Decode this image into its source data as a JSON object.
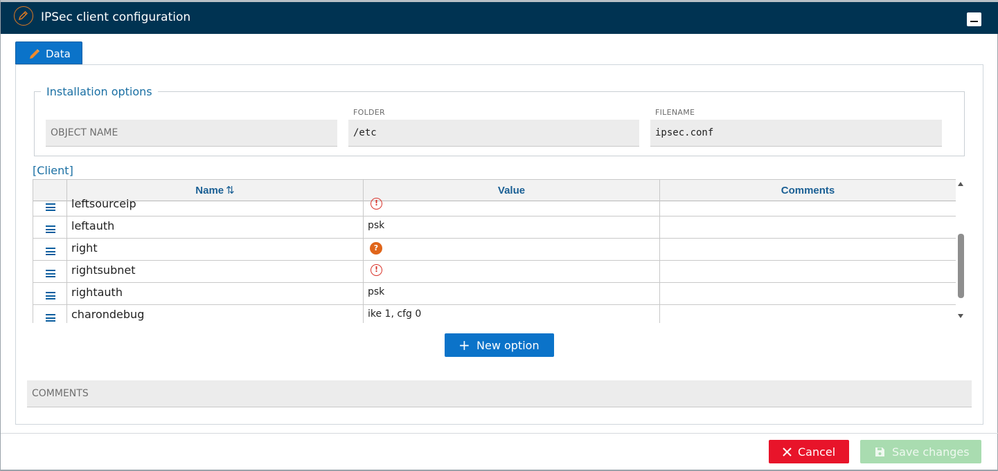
{
  "window": {
    "title": "IPSec client configuration"
  },
  "tabs": [
    {
      "label": "Data",
      "active": true
    }
  ],
  "installation_options": {
    "legend": "Installation options",
    "object_name": {
      "label": "",
      "placeholder": "OBJECT NAME",
      "value": ""
    },
    "folder": {
      "label": "FOLDER",
      "value": "/etc"
    },
    "filename": {
      "label": "FILENAME",
      "value": "ipsec.conf"
    }
  },
  "client_section": {
    "title": "[Client]",
    "columns": {
      "name": "Name",
      "name_sort": "⇅",
      "value": "Value",
      "comments": "Comments"
    },
    "rows": [
      {
        "name": "leftsourceip",
        "value": "",
        "status": "error",
        "comments": ""
      },
      {
        "name": "leftauth",
        "value": "psk",
        "status": "",
        "comments": ""
      },
      {
        "name": "right",
        "value": "",
        "status": "help",
        "comments": ""
      },
      {
        "name": "rightsubnet",
        "value": "",
        "status": "error",
        "comments": ""
      },
      {
        "name": "rightauth",
        "value": "psk",
        "status": "",
        "comments": ""
      },
      {
        "name": "charondebug",
        "value": "ike 1, cfg 0",
        "status": "",
        "comments": ""
      }
    ]
  },
  "new_option_button": {
    "icon": "+",
    "label": "New option"
  },
  "comments_field": {
    "placeholder": "COMMENTS",
    "value": ""
  },
  "footer": {
    "cancel_label": "Cancel",
    "save_label": "Save changes"
  },
  "icons": {
    "error_glyph": "!",
    "help_glyph": "?"
  },
  "colors": {
    "titlebar": "#003352",
    "accent": "#0b73c9",
    "cancel": "#e8142a",
    "save_disabled": "#a9dcb0",
    "error": "#d9342b",
    "help": "#e0651a",
    "title_icon": "#e07b22"
  }
}
